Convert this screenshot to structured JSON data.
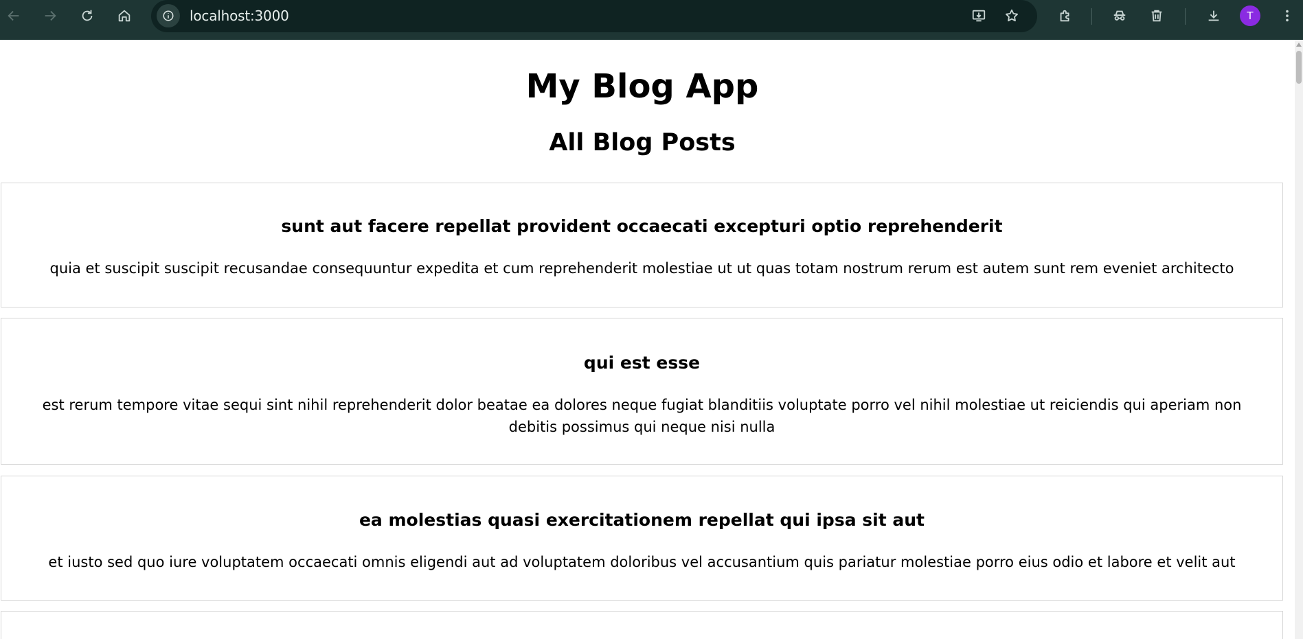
{
  "browser": {
    "url": "localhost:3000",
    "profile_initial": "T",
    "profile_color": "#8a2be2"
  },
  "page": {
    "app_title": "My Blog App",
    "section_title": "All Blog Posts",
    "posts": [
      {
        "title": "sunt aut facere repellat provident occaecati excepturi optio reprehenderit",
        "body": "quia et suscipit suscipit recusandae consequuntur expedita et cum reprehenderit molestiae ut ut quas totam nostrum rerum est autem sunt rem eveniet architecto"
      },
      {
        "title": "qui est esse",
        "body": "est rerum tempore vitae sequi sint nihil reprehenderit dolor beatae ea dolores neque fugiat blanditiis voluptate porro vel nihil molestiae ut reiciendis qui aperiam non debitis possimus qui neque nisi nulla"
      },
      {
        "title": "ea molestias quasi exercitationem repellat qui ipsa sit aut",
        "body": "et iusto sed quo iure voluptatem occaecati omnis eligendi aut ad voluptatem doloribus vel accusantium quis pariatur molestiae porro eius odio et labore et velit aut"
      }
    ]
  }
}
